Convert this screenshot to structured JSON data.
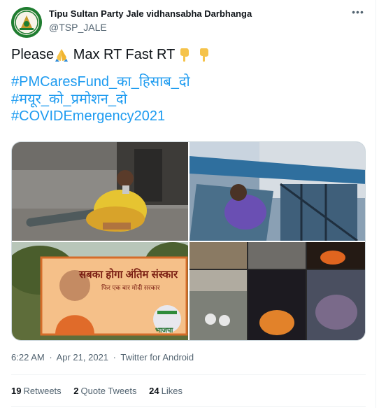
{
  "tweet": {
    "display_name": "Tipu Sultan Party Jale vidhansabha Darbhanga",
    "handle": "@TSP_JALE",
    "text_prefix": "Please",
    "text_middle": " Max RT Fast RT",
    "hashtags": [
      "#PMCaresFund_का_हिसाब_दो",
      "#मयूर_को_प्रमोशन_दो",
      "#COVIDEmergency2021"
    ],
    "time": "6:22 AM",
    "date": "Apr 21, 2021",
    "source": "Twitter for Android",
    "separator": "·",
    "more_icon": "more-horizontal-icon",
    "emojis": [
      "folded-hands-emoji",
      "pointing-down-emoji",
      "pointing-down-emoji"
    ]
  },
  "media": {
    "billboard_title": "सबका होगा अंतिम संस्कार",
    "billboard_subtitle": "फिर एक बार मोदी सरकार",
    "billboard_party": "भाजपा"
  },
  "stats": [
    {
      "count": "19",
      "label": "Retweets"
    },
    {
      "count": "2",
      "label": "Quote Tweets"
    },
    {
      "count": "24",
      "label": "Likes"
    }
  ],
  "colors": {
    "accent": "#1d9bf0",
    "text": "#0f1419",
    "secondary": "#536471",
    "border": "#eff3f4"
  }
}
